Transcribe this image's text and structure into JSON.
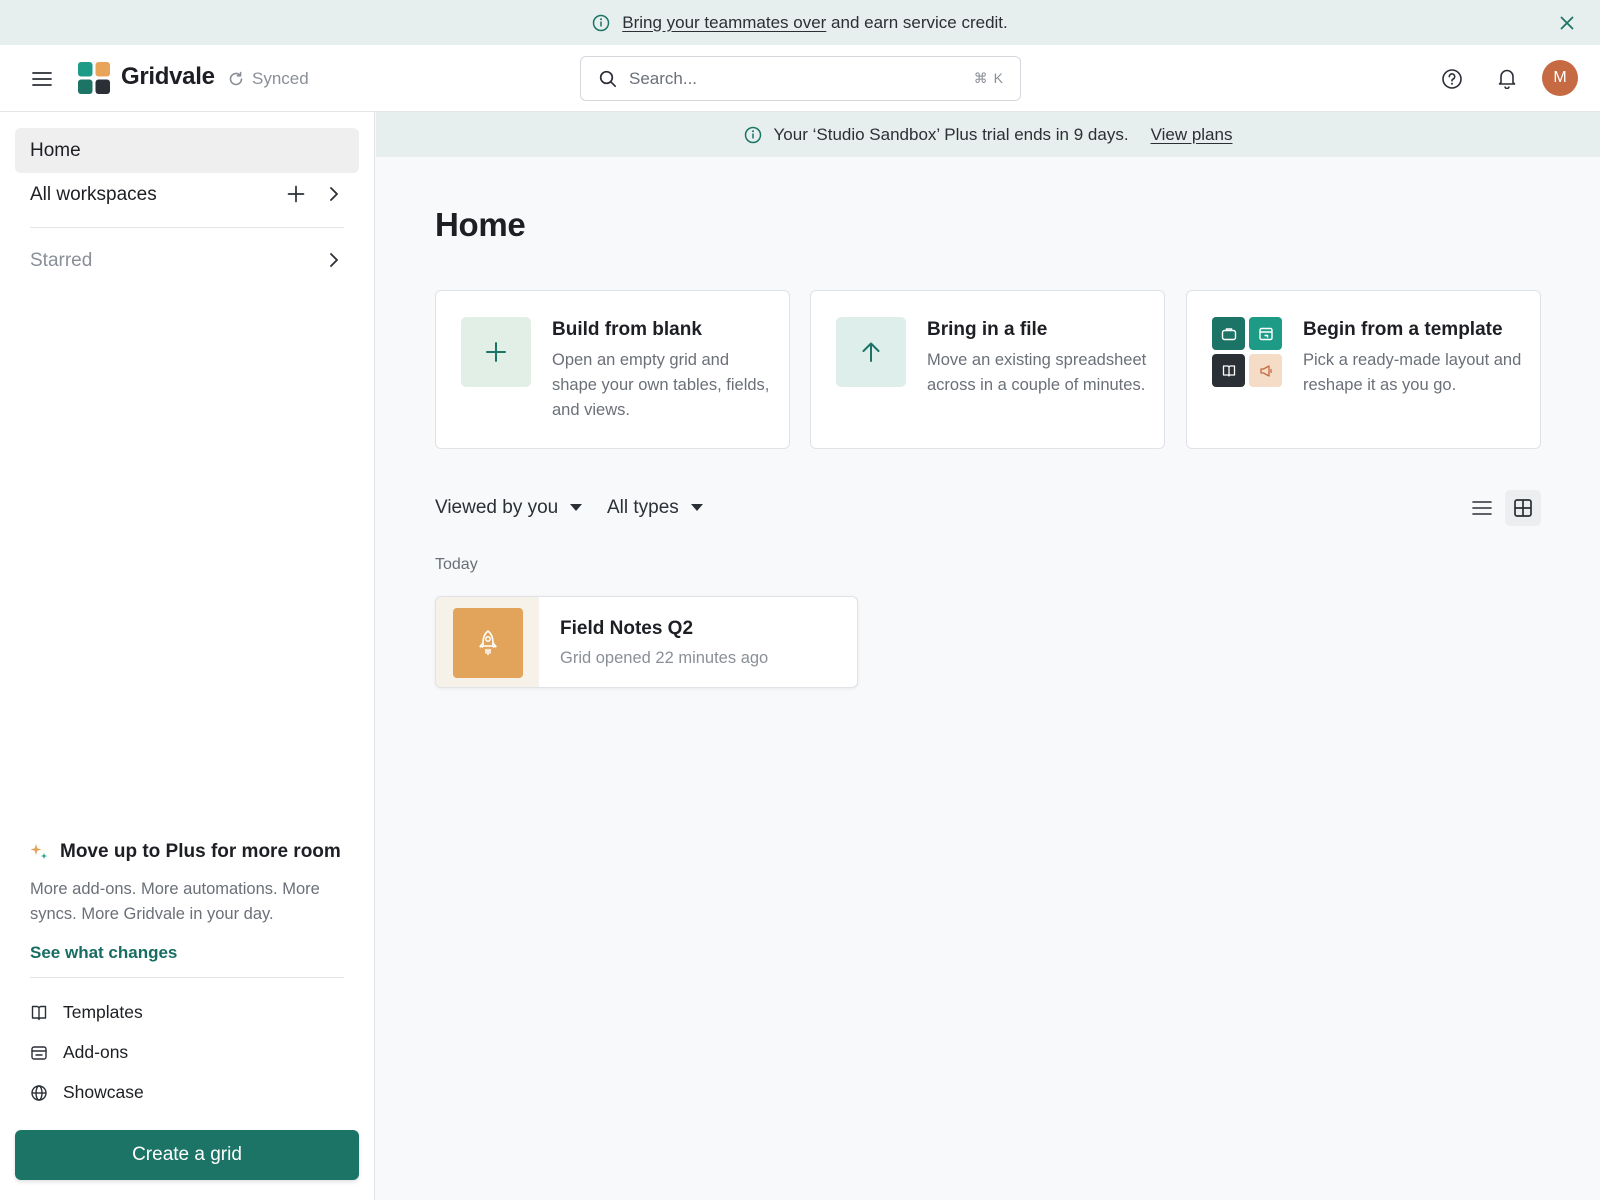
{
  "colors": {
    "accent": "#1b7466",
    "banner_bg": "#e6efed",
    "avatar": "#c56a42",
    "recent_icon": "#e2a35a",
    "link": "#186d62"
  },
  "promo_banner": {
    "icon": "info-icon",
    "link_text": "Bring your teammates over",
    "rest_text": " and earn service credit.",
    "close_icon": "close-icon"
  },
  "header": {
    "menu_icon": "hamburger-icon",
    "brand": "Gridvale",
    "sync_status": "Synced",
    "search": {
      "placeholder": "Search...",
      "shortcut": "⌘ K"
    },
    "avatar_initial": "M"
  },
  "sidebar": {
    "home": "Home",
    "all_workspaces": "All workspaces",
    "starred": "Starred",
    "upsell": {
      "title": "Move up to Plus for more room",
      "body": "More add-ons. More automations. More syncs. More Gridvale in your day.",
      "link": "See what changes"
    },
    "footer_links": [
      {
        "label": "Templates",
        "icon": "book-icon"
      },
      {
        "label": "Add-ons",
        "icon": "addons-icon"
      },
      {
        "label": "Showcase",
        "icon": "globe-icon"
      }
    ],
    "create_button": "Create a grid"
  },
  "trial_banner": {
    "text": "Your ‘Studio Sandbox’ Plus trial ends in 9 days.",
    "link": "View plans"
  },
  "main": {
    "title": "Home",
    "start_cards": [
      {
        "title": "Build from blank",
        "description": "Open an empty grid and shape your own tables, fields, and views.",
        "icon": "plus-icon"
      },
      {
        "title": "Bring in a file",
        "description": "Move an existing spreadsheet across in a couple of minutes.",
        "icon": "arrow-up-icon"
      },
      {
        "title": "Begin from a template",
        "description": "Pick a ready-made layout and reshape it as you go.",
        "icon": "template-icons"
      }
    ],
    "filters": {
      "viewed": "Viewed by you",
      "types": "All types"
    },
    "section_label": "Today",
    "recent_items": [
      {
        "title": "Field Notes Q2",
        "meta": "Grid opened 22 minutes ago",
        "icon": "rocket-icon"
      }
    ]
  }
}
